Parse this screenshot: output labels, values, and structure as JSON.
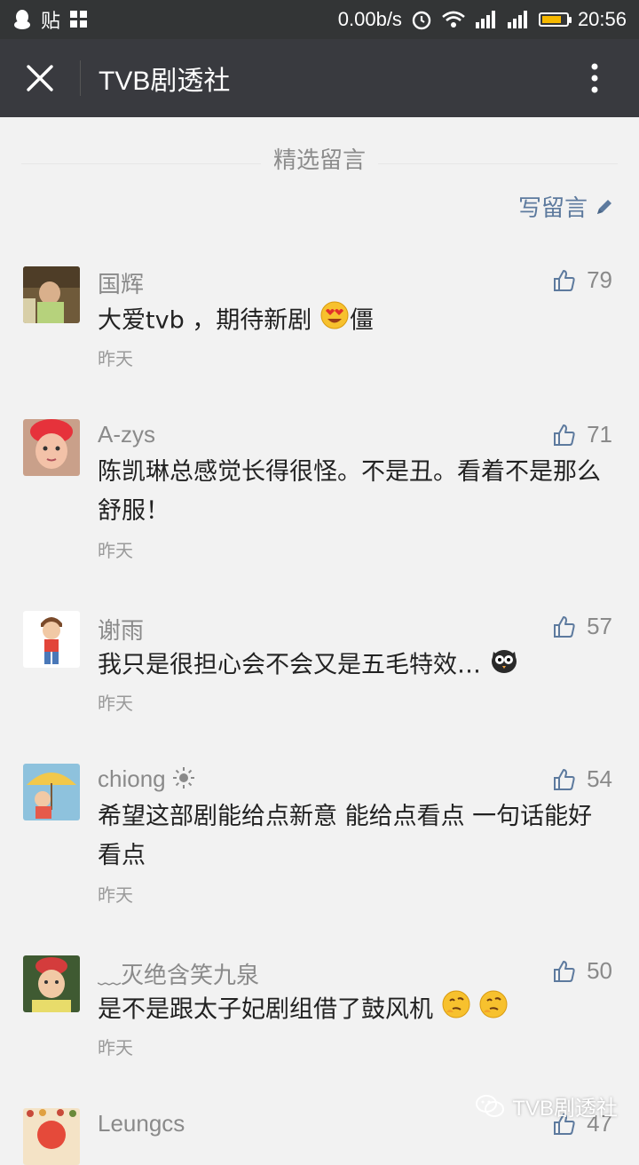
{
  "status_bar": {
    "left_text": "贴",
    "speed": "0.00b/s",
    "time": "20:56"
  },
  "navbar": {
    "title": "TVB剧透社"
  },
  "section": {
    "title": "精选留言",
    "write_label": "写留言"
  },
  "comments": [
    {
      "name": "国辉",
      "likes": "79",
      "text": "大爱tvb ，期待新剧",
      "text_suffix": "僵",
      "time": "昨天"
    },
    {
      "name": "A-zys",
      "likes": "71",
      "text": "陈凯琳总感觉长得很怪。不是丑。看着不是那么舒服！",
      "time": "昨天"
    },
    {
      "name": "谢雨",
      "likes": "57",
      "text": "我只是很担心会不会又是五毛特效…",
      "time": "昨天"
    },
    {
      "name": "chiong",
      "likes": "54",
      "text": "希望这部剧能给点新意 能给点看点 一句话能好看点",
      "time": "昨天"
    },
    {
      "name": "灭绝含笑九泉",
      "name_prefix": "﹏",
      "likes": "50",
      "text": "是不是跟太子妃剧组借了鼓风机",
      "time": "昨天"
    },
    {
      "name": "Leungcs",
      "likes": "47"
    }
  ],
  "watermark": "TVB剧透社",
  "colors": {
    "status_bg": "#333536",
    "nav_bg": "#393a3f",
    "page_bg": "#f2f2f2",
    "link": "#5d7a9e",
    "battery": "#f5b800"
  }
}
